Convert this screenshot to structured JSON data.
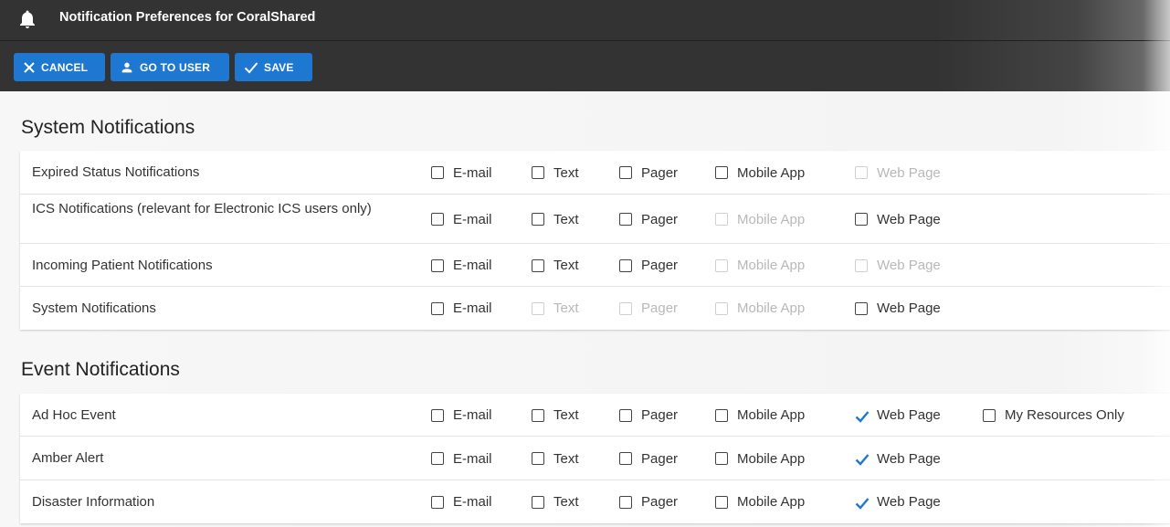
{
  "header": {
    "title": "Notification Preferences for CoralShared",
    "icon": "bell-icon"
  },
  "toolbar": {
    "cancel_label": "CANCEL",
    "go_to_user_label": "GO TO USER",
    "save_label": "SAVE"
  },
  "colors": {
    "header_bg": "#333333",
    "button_bg": "#1e78d2",
    "check_color": "#1e78d2"
  },
  "system_section": {
    "title": "System Notifications",
    "rows": [
      {
        "label": "Expired Status Notifications",
        "options": [
          {
            "label": "E-mail",
            "checked": false,
            "disabled": false
          },
          {
            "label": "Text",
            "checked": false,
            "disabled": false
          },
          {
            "label": "Pager",
            "checked": false,
            "disabled": false
          },
          {
            "label": "Mobile App",
            "checked": false,
            "disabled": false
          },
          {
            "label": "Web Page",
            "checked": false,
            "disabled": true
          }
        ]
      },
      {
        "label": "ICS Notifications (relevant for Electronic ICS users only)",
        "options": [
          {
            "label": "E-mail",
            "checked": false,
            "disabled": false
          },
          {
            "label": "Text",
            "checked": false,
            "disabled": false
          },
          {
            "label": "Pager",
            "checked": false,
            "disabled": false
          },
          {
            "label": "Mobile App",
            "checked": false,
            "disabled": true
          },
          {
            "label": "Web Page",
            "checked": false,
            "disabled": false
          }
        ]
      },
      {
        "label": "Incoming Patient Notifications",
        "options": [
          {
            "label": "E-mail",
            "checked": false,
            "disabled": false
          },
          {
            "label": "Text",
            "checked": false,
            "disabled": false
          },
          {
            "label": "Pager",
            "checked": false,
            "disabled": false
          },
          {
            "label": "Mobile App",
            "checked": false,
            "disabled": true
          },
          {
            "label": "Web Page",
            "checked": false,
            "disabled": true
          }
        ]
      },
      {
        "label": "System Notifications",
        "options": [
          {
            "label": "E-mail",
            "checked": false,
            "disabled": false
          },
          {
            "label": "Text",
            "checked": false,
            "disabled": true
          },
          {
            "label": "Pager",
            "checked": false,
            "disabled": true
          },
          {
            "label": "Mobile App",
            "checked": false,
            "disabled": true
          },
          {
            "label": "Web Page",
            "checked": false,
            "disabled": false
          }
        ]
      }
    ]
  },
  "event_section": {
    "title": "Event Notifications",
    "rows": [
      {
        "label": "Ad Hoc Event",
        "options": [
          {
            "label": "E-mail",
            "checked": false,
            "disabled": false
          },
          {
            "label": "Text",
            "checked": false,
            "disabled": false
          },
          {
            "label": "Pager",
            "checked": false,
            "disabled": false
          },
          {
            "label": "Mobile App",
            "checked": false,
            "disabled": false
          },
          {
            "label": "Web Page",
            "checked": true,
            "disabled": false
          },
          {
            "label": "My Resources Only",
            "checked": false,
            "disabled": false
          }
        ]
      },
      {
        "label": "Amber Alert",
        "options": [
          {
            "label": "E-mail",
            "checked": false,
            "disabled": false
          },
          {
            "label": "Text",
            "checked": false,
            "disabled": false
          },
          {
            "label": "Pager",
            "checked": false,
            "disabled": false
          },
          {
            "label": "Mobile App",
            "checked": false,
            "disabled": false
          },
          {
            "label": "Web Page",
            "checked": true,
            "disabled": false
          }
        ]
      },
      {
        "label": "Disaster Information",
        "options": [
          {
            "label": "E-mail",
            "checked": false,
            "disabled": false
          },
          {
            "label": "Text",
            "checked": false,
            "disabled": false
          },
          {
            "label": "Pager",
            "checked": false,
            "disabled": false
          },
          {
            "label": "Mobile App",
            "checked": false,
            "disabled": false
          },
          {
            "label": "Web Page",
            "checked": true,
            "disabled": false
          }
        ]
      }
    ]
  }
}
